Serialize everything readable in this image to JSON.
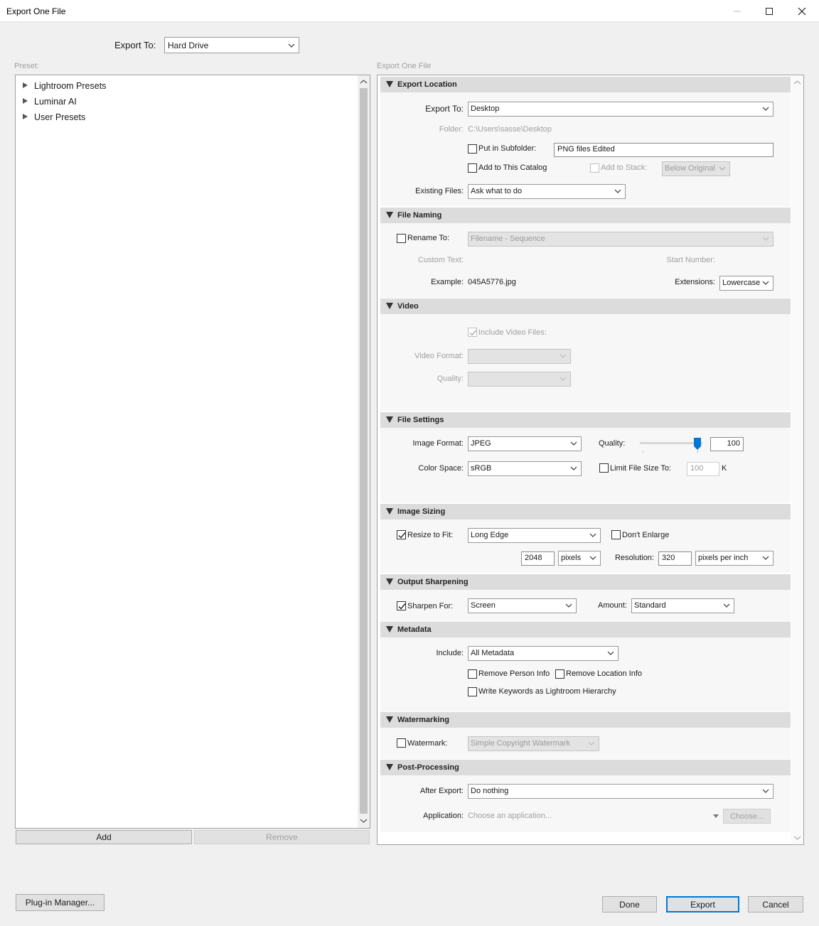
{
  "window": {
    "title": "Export One File",
    "minimize_icon": "minimize-icon",
    "maximize_icon": "maximize-icon",
    "close_icon": "close-icon"
  },
  "top": {
    "export_to_label": "Export To:",
    "export_to_value": "Hard Drive"
  },
  "preset": {
    "label": "Preset:",
    "items": [
      "Lightroom Presets",
      "Luminar AI",
      "User Presets"
    ],
    "add_label": "Add",
    "remove_label": "Remove"
  },
  "panel_title": "Export One File",
  "export_location": {
    "header": "Export Location",
    "export_to_label": "Export To:",
    "export_to_value": "Desktop",
    "folder_label": "Folder:",
    "folder_value": "C:\\Users\\sasse\\Desktop",
    "subfolder_label": "Put in Subfolder:",
    "subfolder_value": "PNG files Edited",
    "add_catalog_label": "Add to This Catalog",
    "add_stack_label": "Add to Stack:",
    "add_stack_value": "Below Original",
    "existing_label": "Existing Files:",
    "existing_value": "Ask what to do"
  },
  "file_naming": {
    "header": "File Naming",
    "rename_label": "Rename To:",
    "rename_value": "Filename - Sequence",
    "custom_text_label": "Custom Text:",
    "start_number_label": "Start Number:",
    "example_label": "Example:",
    "example_value": "045A5776.jpg",
    "extensions_label": "Extensions:",
    "extensions_value": "Lowercase"
  },
  "video": {
    "header": "Video",
    "include_label": "Include Video Files:",
    "format_label": "Video Format:",
    "quality_label": "Quality:"
  },
  "file_settings": {
    "header": "File Settings",
    "image_format_label": "Image Format:",
    "image_format_value": "JPEG",
    "quality_label": "Quality:",
    "quality_value": "100",
    "color_space_label": "Color Space:",
    "color_space_value": "sRGB",
    "limit_label": "Limit File Size To:",
    "limit_value": "100",
    "limit_unit": "K"
  },
  "image_sizing": {
    "header": "Image Sizing",
    "resize_label": "Resize to Fit:",
    "resize_value": "Long Edge",
    "dont_enlarge_label": "Don't Enlarge",
    "size_value": "2048",
    "size_unit": "pixels",
    "resolution_label": "Resolution:",
    "resolution_value": "320",
    "resolution_unit": "pixels per inch"
  },
  "output_sharpening": {
    "header": "Output Sharpening",
    "sharpen_label": "Sharpen For:",
    "sharpen_value": "Screen",
    "amount_label": "Amount:",
    "amount_value": "Standard"
  },
  "metadata": {
    "header": "Metadata",
    "include_label": "Include:",
    "include_value": "All Metadata",
    "remove_person_label": "Remove Person Info",
    "remove_location_label": "Remove Location Info",
    "write_keywords_label": "Write Keywords as Lightroom Hierarchy"
  },
  "watermarking": {
    "header": "Watermarking",
    "watermark_label": "Watermark:",
    "watermark_value": "Simple Copyright Watermark"
  },
  "post_processing": {
    "header": "Post-Processing",
    "after_export_label": "After Export:",
    "after_export_value": "Do nothing",
    "application_label": "Application:",
    "application_placeholder": "Choose an application...",
    "choose_label": "Choose..."
  },
  "footer": {
    "plugin_manager_label": "Plug-in Manager...",
    "done_label": "Done",
    "export_label": "Export",
    "cancel_label": "Cancel"
  }
}
